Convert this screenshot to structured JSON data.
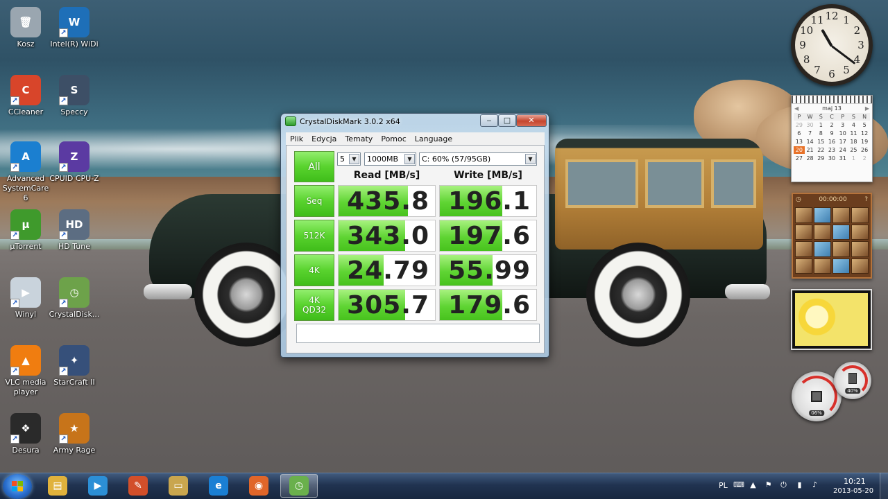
{
  "desktop": {
    "icons": [
      {
        "label": "Kosz",
        "icon": "recycle-bin-icon"
      },
      {
        "label": "Intel(R) WiDi",
        "icon": "widi-icon"
      },
      {
        "label": "CCleaner",
        "icon": "ccleaner-icon"
      },
      {
        "label": "Speccy",
        "icon": "speccy-icon"
      },
      {
        "label": "Advanced SystemCare 6",
        "icon": "systemcare-icon"
      },
      {
        "label": "CPUID CPU-Z",
        "icon": "cpuz-icon"
      },
      {
        "label": "µTorrent",
        "icon": "utorrent-icon"
      },
      {
        "label": "HD Tune",
        "icon": "hdtune-icon"
      },
      {
        "label": "Winyl",
        "icon": "winyl-icon"
      },
      {
        "label": "CrystalDisk...",
        "icon": "crystaldisk-icon"
      },
      {
        "label": "VLC media player",
        "icon": "vlc-icon"
      },
      {
        "label": "StarCraft II",
        "icon": "starcraft-icon"
      },
      {
        "label": "Desura",
        "icon": "desura-icon"
      },
      {
        "label": "Army Rage",
        "icon": "army-rage-icon"
      }
    ]
  },
  "gadgets": {
    "clock": {
      "numerals": [
        "12",
        "1",
        "2",
        "3",
        "4",
        "5",
        "6",
        "7",
        "8",
        "9",
        "10",
        "11"
      ]
    },
    "calendar": {
      "month": "maj 13",
      "weekdays": [
        "P",
        "W",
        "Ś",
        "C",
        "P",
        "S",
        "N"
      ],
      "weeks": [
        [
          "29",
          "30",
          "1",
          "2",
          "3",
          "4",
          "5"
        ],
        [
          "6",
          "7",
          "8",
          "9",
          "10",
          "11",
          "12"
        ],
        [
          "13",
          "14",
          "15",
          "16",
          "17",
          "18",
          "19"
        ],
        [
          "20",
          "21",
          "22",
          "23",
          "24",
          "25",
          "26"
        ],
        [
          "27",
          "28",
          "29",
          "30",
          "31",
          "1",
          "2"
        ]
      ],
      "today": "20"
    },
    "puzzle": {
      "timer": "00:00:00"
    },
    "meters": {
      "cpu_percent": "06%",
      "memory_percent": "40%"
    }
  },
  "window": {
    "title": "CrystalDiskMark 3.0.2 x64",
    "menu": [
      "Plik",
      "Edycja",
      "Tematy",
      "Pomoc",
      "Language"
    ],
    "all_button": "All",
    "runs": "5",
    "size": "1000MB",
    "drive": "C: 60% (57/95GB)",
    "read_header": "Read [MB/s]",
    "write_header": "Write [MB/s]",
    "rows": [
      {
        "label": "Seq",
        "read": "435.8",
        "write": "196.1",
        "read_fill": 0.72,
        "write_fill": 0.65
      },
      {
        "label": "512K",
        "read": "343.0",
        "write": "197.6",
        "read_fill": 0.69,
        "write_fill": 0.65
      },
      {
        "label": "4K",
        "read": "24.79",
        "write": "55.99",
        "read_fill": 0.47,
        "write_fill": 0.55
      },
      {
        "label": "4K\nQD32",
        "read": "305.7",
        "write": "179.6",
        "read_fill": 0.69,
        "write_fill": 0.65
      }
    ]
  },
  "taskbar": {
    "items": [
      {
        "icon": "explorer-icon"
      },
      {
        "icon": "media-player-icon"
      },
      {
        "icon": "paint-icon"
      },
      {
        "icon": "notes-icon"
      },
      {
        "icon": "internet-explorer-icon"
      },
      {
        "icon": "firefox-icon"
      },
      {
        "icon": "crystaldiskmark-icon",
        "active": true
      }
    ],
    "language": "PL",
    "time": "10:21",
    "date": "2013-05-20"
  }
}
